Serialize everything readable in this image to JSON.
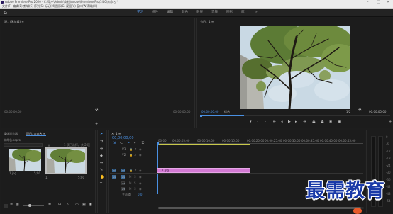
{
  "window": {
    "title": "Adobe Premiere Pro 2020 - C:\\用户\\Admin\\文档\\Adobe\\Premiere Pro\\14.0\\未命名 *",
    "controls": [
      "–",
      "□",
      "✕"
    ]
  },
  "menu": [
    "文件(F)",
    "编辑(E)",
    "剪辑(C)",
    "序列(S)",
    "标记(M)",
    "图形(G)",
    "视图(V)",
    "窗口(W)",
    "帮助(H)"
  ],
  "workspaces": {
    "items": [
      "学习",
      "组件",
      "编辑",
      "颜色",
      "效果",
      "音频",
      "图形",
      "库"
    ],
    "active_index": 0,
    "overflow": "»"
  },
  "source_monitor": {
    "title": "源：(无剪辑) ≡",
    "timecode_left": "00;00;00;00",
    "timecode_right": "00;00;00;00"
  },
  "program_monitor": {
    "title": "节目：1 ≡",
    "timecode_left": "00;00;00;00",
    "fit_label": "适合",
    "quality": "1/2",
    "timecode_right": "00;00;05;00",
    "icons": [
      "marker-icon",
      "in-point-icon",
      "out-point-icon",
      "go-to-in-icon",
      "step-back-icon",
      "play-icon",
      "step-forward-icon",
      "go-to-out-icon",
      "lift-icon",
      "extract-icon",
      "export-frame-icon",
      "add-icon"
    ]
  },
  "project_panel": {
    "tabs": [
      "媒体浏览器",
      "项目: 未命名 ≡"
    ],
    "project_file": "未命名.prproj",
    "item_count": "1 项已选择，共 2 项",
    "items": [
      {
        "name": "1.jpg",
        "duration": "5;00"
      },
      {
        "name": "1",
        "duration": "5;00"
      }
    ]
  },
  "timeline": {
    "sequence_tab": "1 ≡",
    "timecode": "00;00;00;00",
    "ruler_labels": [
      "00;00",
      "00;00;05;00",
      "00;00;10;00",
      "00;00;15;00",
      "00;00;20;00",
      "00;00;25;00",
      "00;00;30;00",
      "00;00;35;00",
      "00;00;40;00",
      "00;00;45;00"
    ],
    "tracks": [
      {
        "id": "V3",
        "toggle": "V1"
      },
      {
        "id": "V2",
        "toggle": "V1"
      },
      {
        "id": "V1",
        "toggle": "V1"
      },
      {
        "id": "A1",
        "toggle": "A1"
      },
      {
        "id": "A2",
        "toggle": "A1"
      },
      {
        "id": "A3",
        "toggle": "A1"
      }
    ],
    "master_label": "主声道",
    "master_value": "0.0",
    "clip_label": "1.jpg"
  },
  "meters": {
    "scale": [
      "0",
      "-6",
      "-12",
      "-18",
      "-24",
      "-30",
      "-36",
      "-42",
      "-48",
      "-54"
    ]
  },
  "watermark": {
    "text": "最需教育"
  }
}
